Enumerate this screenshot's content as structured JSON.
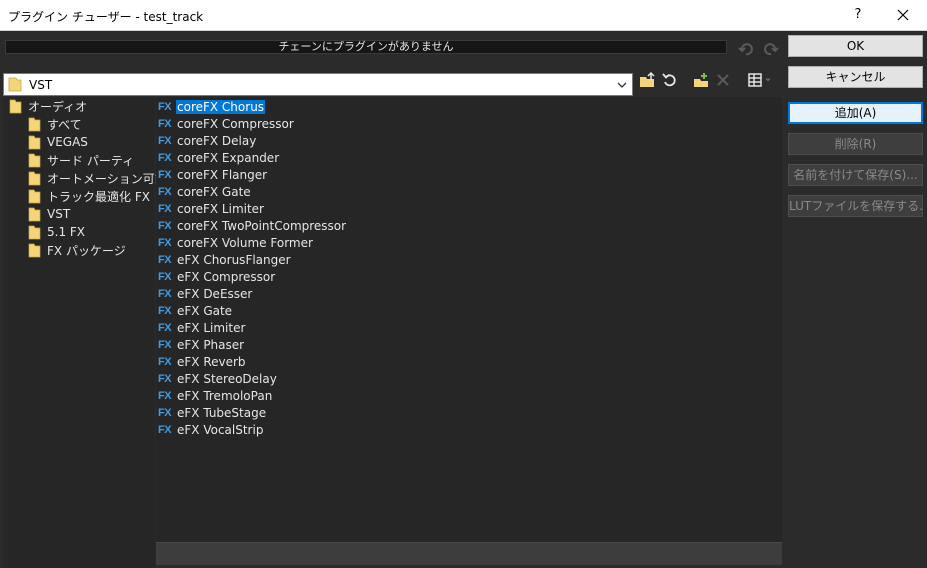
{
  "window": {
    "title": "プラグイン チューザー - test_track",
    "help_label": "?"
  },
  "chain": {
    "empty_text": "チェーンにプラグインがありません"
  },
  "folder_select": {
    "value": "VST"
  },
  "tree": {
    "root": "オーディオ",
    "items": [
      "すべて",
      "VEGAS",
      "サード パーティ",
      "オートメーション可能",
      "トラック最適化 FX",
      "VST",
      "5.1 FX",
      "FX パッケージ"
    ]
  },
  "plugin_badge": "FX",
  "plugins": [
    "coreFX Chorus",
    "coreFX Compressor",
    "coreFX Delay",
    "coreFX Expander",
    "coreFX Flanger",
    "coreFX Gate",
    "coreFX Limiter",
    "coreFX TwoPointCompressor",
    "coreFX Volume Former",
    "eFX ChorusFlanger",
    "eFX Compressor",
    "eFX DeEsser",
    "eFX Gate",
    "eFX Limiter",
    "eFX Phaser",
    "eFX Reverb",
    "eFX StereoDelay",
    "eFX TremoloPan",
    "eFX TubeStage",
    "eFX VocalStrip"
  ],
  "buttons": {
    "ok": "OK",
    "cancel": "キャンセル",
    "add": "追加(A)",
    "remove": "削除(R)",
    "save_as": "名前を付けて保存(S)...",
    "save_lut": "LUTファイルを保存する..."
  },
  "colors": {
    "background": "#2b2b2b",
    "panel": "#262626",
    "selection": "#0078d7",
    "fx_badge": "#3e9ce6",
    "folder": "#f5d57a"
  }
}
